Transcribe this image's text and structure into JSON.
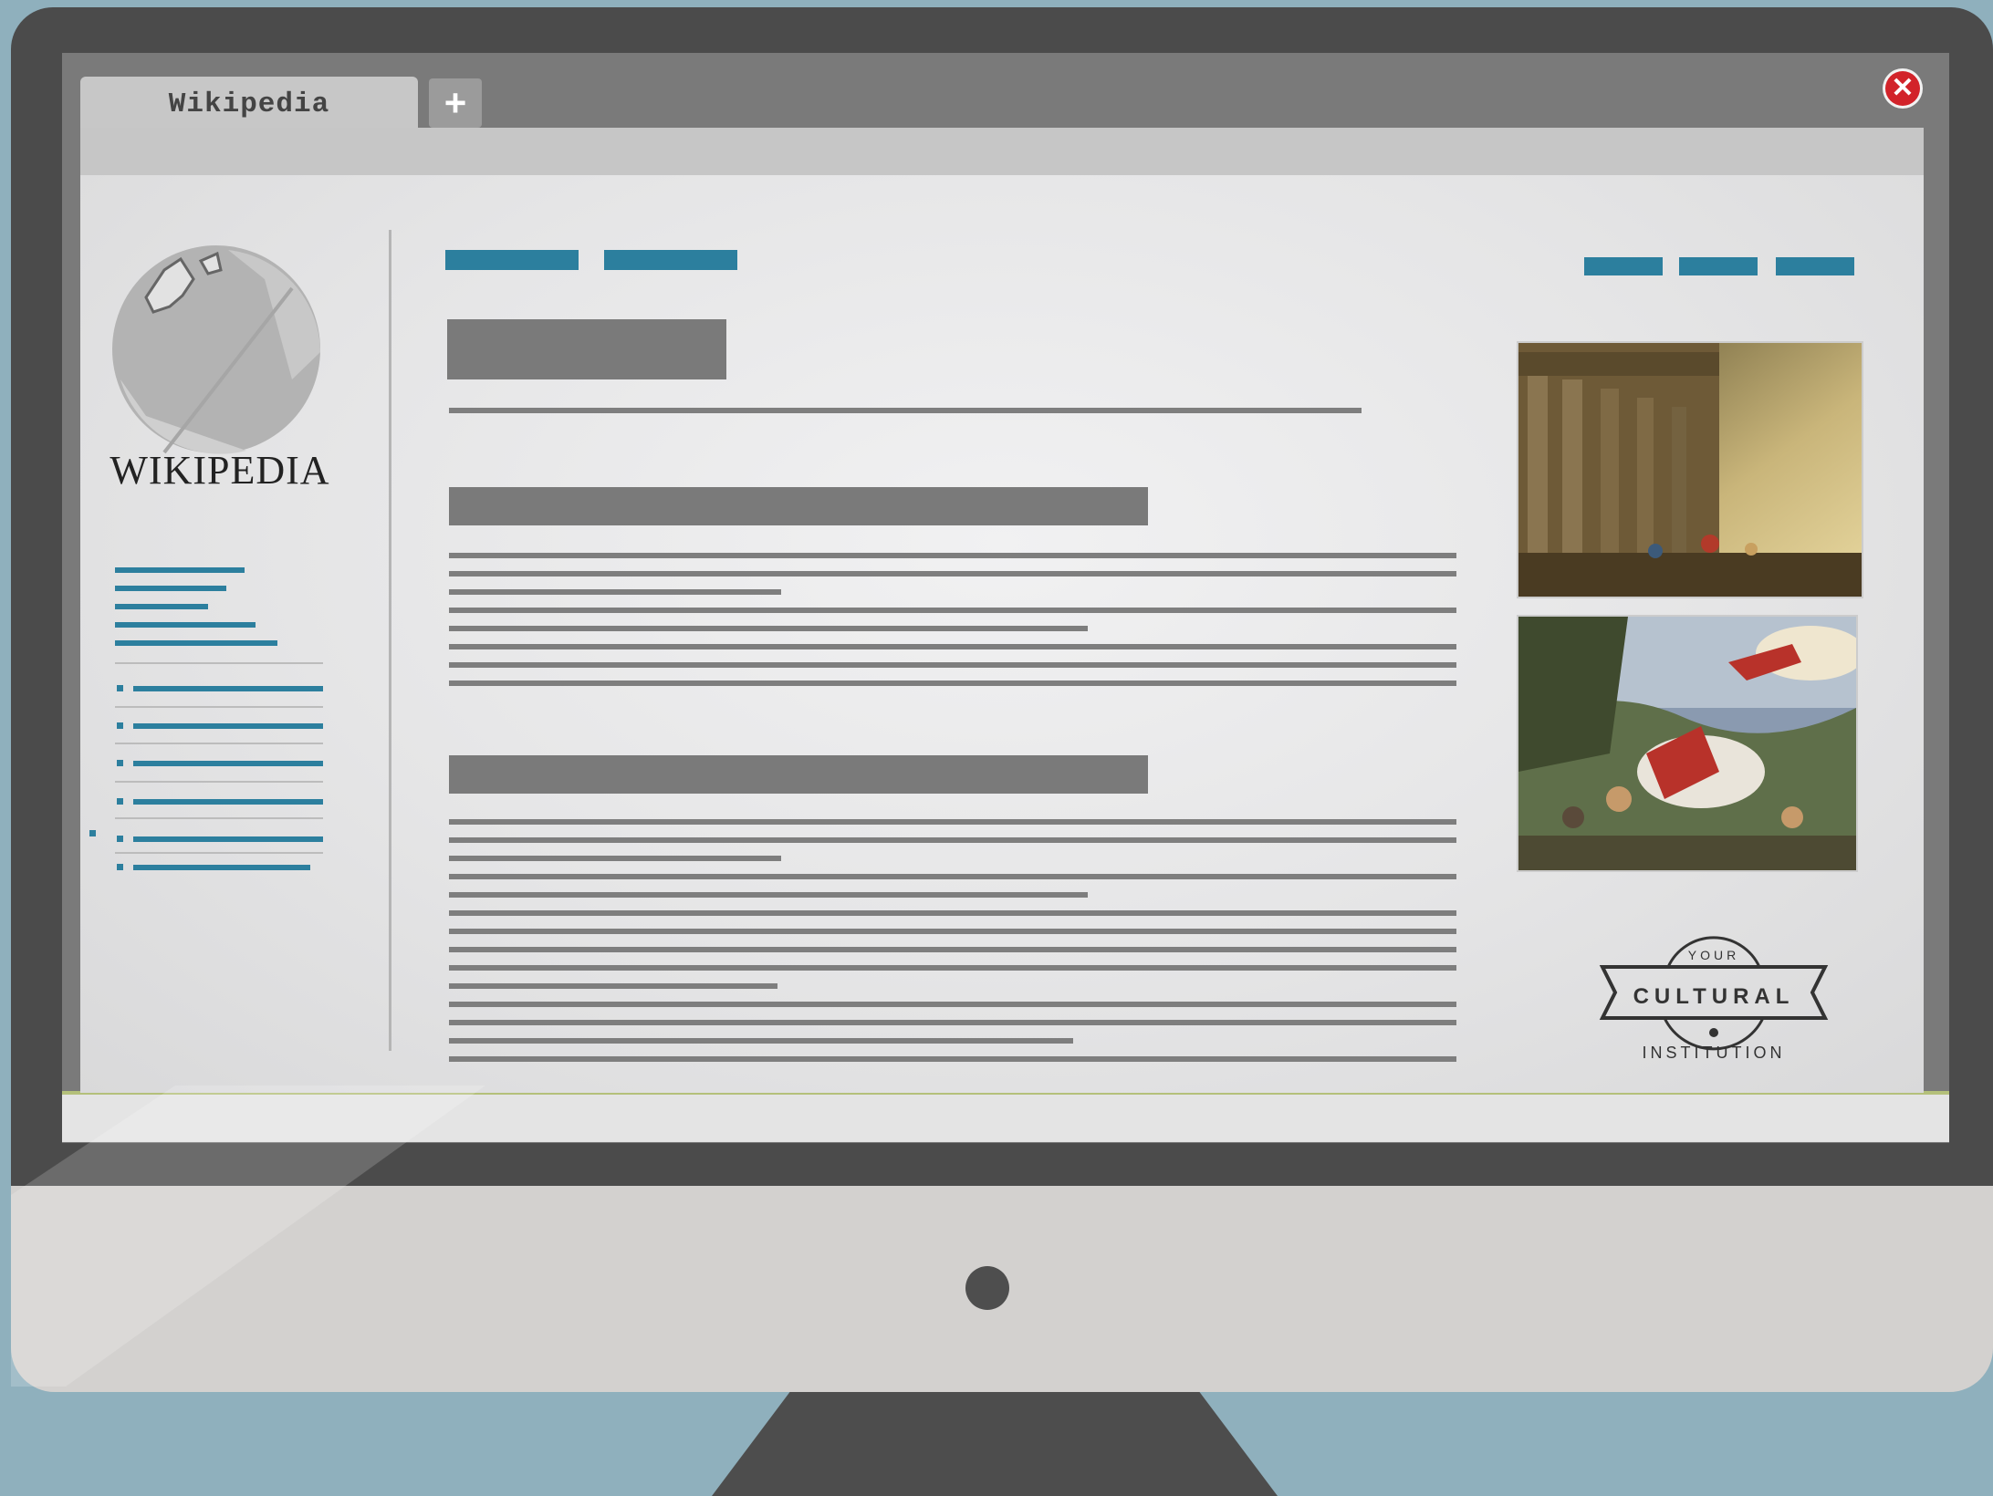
{
  "browser": {
    "tab_title": "Wikipedia",
    "new_tab_label": "+",
    "close_label": "✕"
  },
  "sidebar": {
    "logo_wordmark": "WIKIPEDIA"
  },
  "stamp": {
    "text_top": "YOUR",
    "text_middle": "CULTURAL",
    "text_bottom": "INSTITUTION"
  },
  "colors": {
    "accent": "#2c7f9e",
    "close": "#d2232a",
    "bezel": "#4b4b4b",
    "backdrop": "#8fb0bd"
  },
  "icons": [
    "wikipedia-globe-icon",
    "plus-icon",
    "close-icon",
    "painting-ruins-image",
    "painting-conversion-image",
    "cultural-institution-stamp"
  ]
}
